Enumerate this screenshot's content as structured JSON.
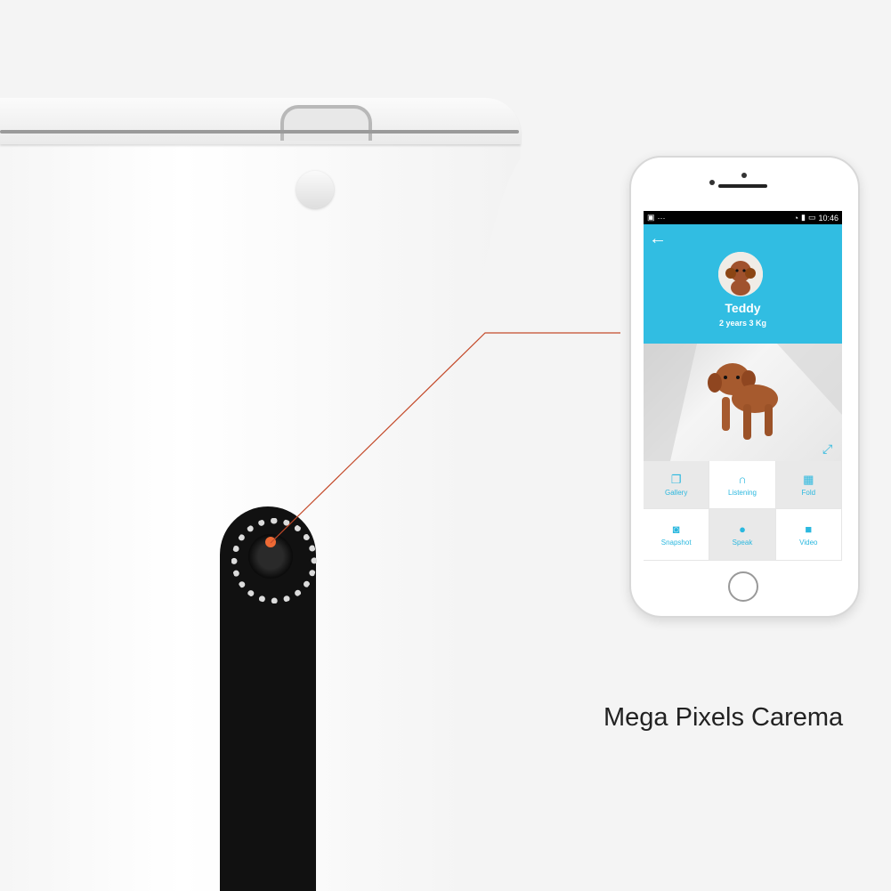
{
  "caption": "Mega Pixels Carema",
  "phone": {
    "status": {
      "time": "10:46"
    },
    "profile": {
      "name": "Teddy",
      "info": "2 years 3 Kg"
    },
    "controls": [
      {
        "label": "Gallery",
        "icon": "gallery-icon"
      },
      {
        "label": "Listening",
        "icon": "headphones-icon"
      },
      {
        "label": "Fold",
        "icon": "film-icon"
      },
      {
        "label": "Snapshot",
        "icon": "camera-icon"
      },
      {
        "label": "Speak",
        "icon": "microphone-icon"
      },
      {
        "label": "Video",
        "icon": "video-camera-icon"
      }
    ],
    "colors": {
      "header": "#31bde2",
      "accent": "#2bb8df"
    }
  },
  "device": {
    "indicator_color": "#ee6a35"
  }
}
